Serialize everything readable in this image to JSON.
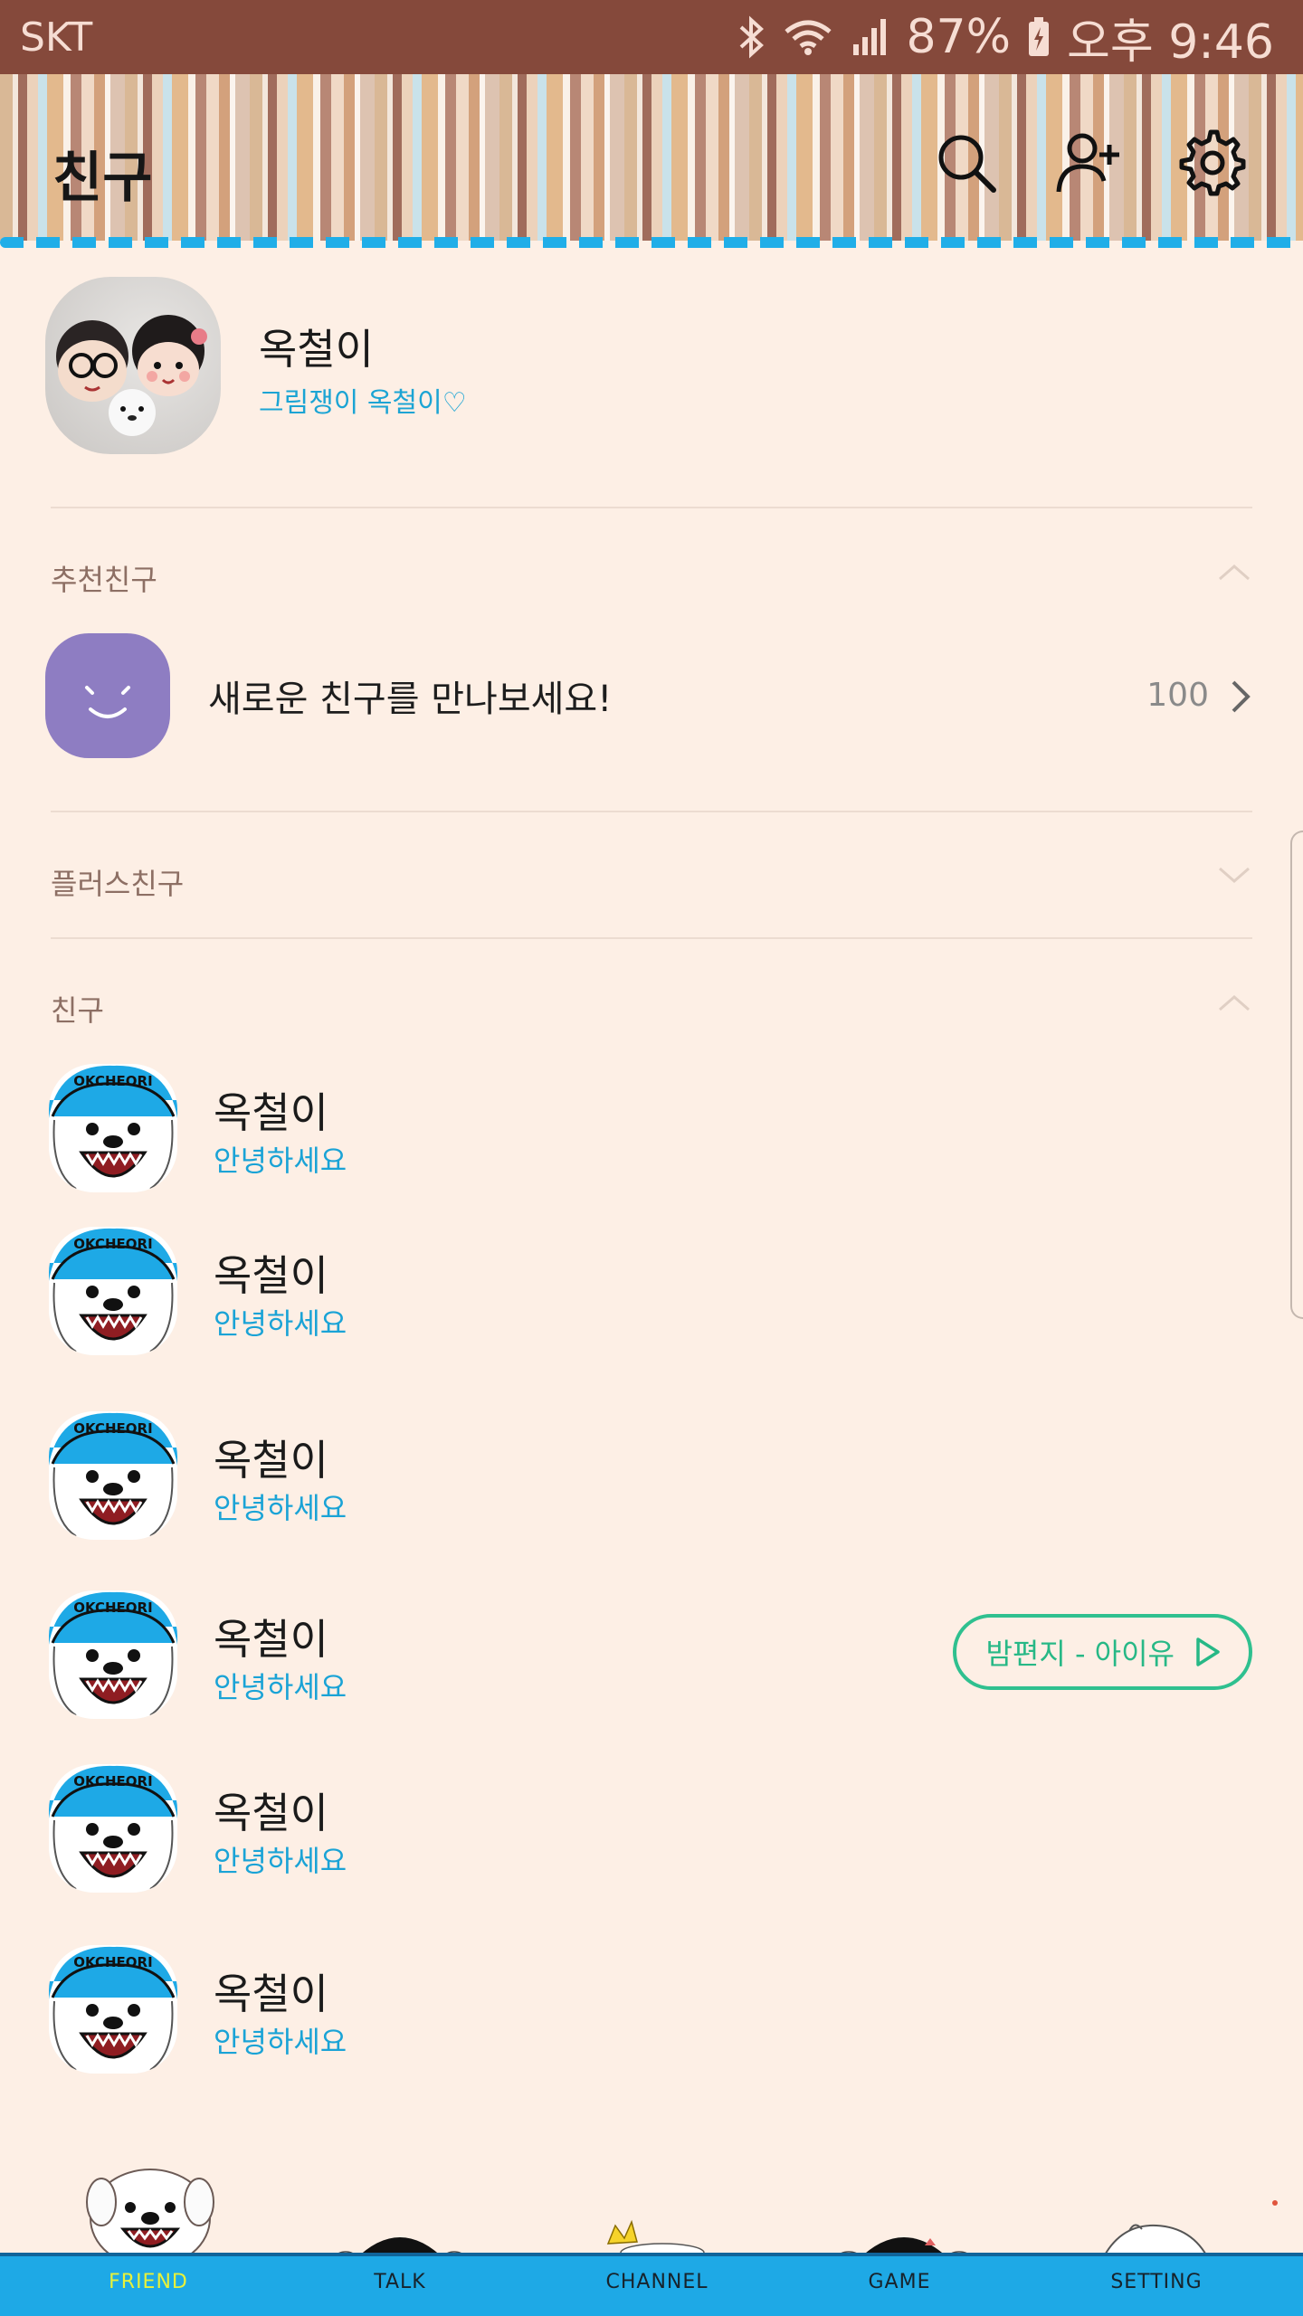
{
  "status_bar": {
    "carrier": "SKT",
    "battery": "87%",
    "time": "오후 9:46"
  },
  "header": {
    "title": "친구",
    "icons": [
      "search-icon",
      "add-friend-icon",
      "settings-icon"
    ]
  },
  "profile": {
    "name": "옥철이",
    "status": "그림쟁이 옥철이♡"
  },
  "sections": {
    "recommended": {
      "label": "추천친구",
      "item_text": "새로운 친구를 만나보세요!",
      "count": "100"
    },
    "plus_friends": {
      "label": "플러스친구"
    },
    "friends": {
      "label": "친구"
    }
  },
  "friends": [
    {
      "name": "옥철이",
      "message": "안녕하세요",
      "avatar_text": "OKCHEORI"
    },
    {
      "name": "옥철이",
      "message": "안녕하세요",
      "avatar_text": "OKCHEORI"
    },
    {
      "name": "옥철이",
      "message": "안녕하세요",
      "avatar_text": "OKCHEORI"
    },
    {
      "name": "옥철이",
      "message": "안녕하세요",
      "avatar_text": "OKCHEORI",
      "music": "밤편지 - 아이유"
    },
    {
      "name": "옥철이",
      "message": "안녕하세요",
      "avatar_text": "OKCHEORI"
    },
    {
      "name": "옥철이",
      "message": "안녕하세요",
      "avatar_text": "OKCHEORI"
    }
  ],
  "tabs": [
    {
      "label": "FRIEND",
      "active": true
    },
    {
      "label": "TALK",
      "active": false
    },
    {
      "label": "CHANNEL",
      "active": false
    },
    {
      "label": "GAME",
      "active": false
    },
    {
      "label": "SETTING",
      "active": false
    }
  ],
  "colors": {
    "status_bar": "#85493b",
    "background": "#fdefe5",
    "accent_blue": "#1ba4d4",
    "music_green": "#2fc08f",
    "tab_bar": "#1ea9e6",
    "tab_active": "#e8f13a"
  }
}
